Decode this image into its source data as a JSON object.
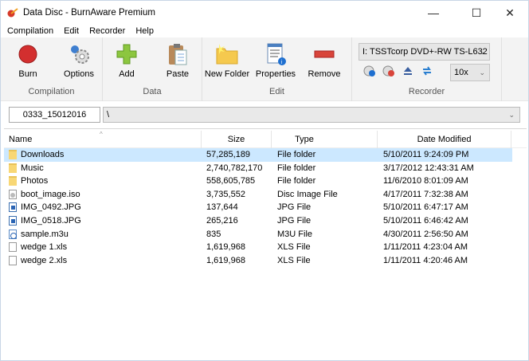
{
  "window": {
    "title": "Data Disc - BurnAware Premium",
    "minimize": "—",
    "maximize": "☐",
    "close": "✕"
  },
  "menu": [
    "Compilation",
    "Edit",
    "Recorder",
    "Help"
  ],
  "ribbon": {
    "groups": {
      "compilation": "Compilation",
      "data": "Data",
      "edit": "Edit",
      "recorder": "Recorder"
    },
    "buttons": {
      "burn": "Burn",
      "options": "Options",
      "add": "Add",
      "paste": "Paste",
      "new_folder": "New Folder",
      "properties": "Properties",
      "remove": "Remove"
    },
    "drive": "I: TSSTcorp DVD+-RW TS-L632",
    "speed": "10x",
    "chev": "⌄"
  },
  "path": {
    "disc_name": "0333_15012016",
    "current": "\\"
  },
  "list": {
    "columns": {
      "name": "Name",
      "size": "Size",
      "type": "Type",
      "date": "Date Modified"
    },
    "sort_indicator": "^",
    "rows": [
      {
        "name": "Downloads",
        "size": "57,285,189",
        "type": "File folder",
        "date": "5/10/2011 9:24:09 PM",
        "icon": "folder"
      },
      {
        "name": "Music",
        "size": "2,740,782,170",
        "type": "File folder",
        "date": "3/17/2012 12:43:31 AM",
        "icon": "folder"
      },
      {
        "name": "Photos",
        "size": "558,605,785",
        "type": "File folder",
        "date": "11/6/2010 8:01:09 AM",
        "icon": "folder"
      },
      {
        "name": "boot_image.iso",
        "size": "3,735,552",
        "type": "Disc Image File",
        "date": "4/17/2011 7:32:38 AM",
        "icon": "disc"
      },
      {
        "name": "IMG_0492.JPG",
        "size": "137,644",
        "type": "JPG File",
        "date": "5/10/2011 6:47:17 AM",
        "icon": "img"
      },
      {
        "name": "IMG_0518.JPG",
        "size": "265,216",
        "type": "JPG File",
        "date": "5/10/2011 6:46:42 AM",
        "icon": "img"
      },
      {
        "name": "sample.m3u",
        "size": "835",
        "type": "M3U File",
        "date": "4/30/2011 2:56:50 AM",
        "icon": "m3u"
      },
      {
        "name": "wedge 1.xls",
        "size": "1,619,968",
        "type": "XLS File",
        "date": "1/11/2011 4:23:04 AM",
        "icon": "doc"
      },
      {
        "name": "wedge 2.xls",
        "size": "1,619,968",
        "type": "XLS File",
        "date": "1/11/2011 4:20:46 AM",
        "icon": "doc"
      }
    ]
  }
}
